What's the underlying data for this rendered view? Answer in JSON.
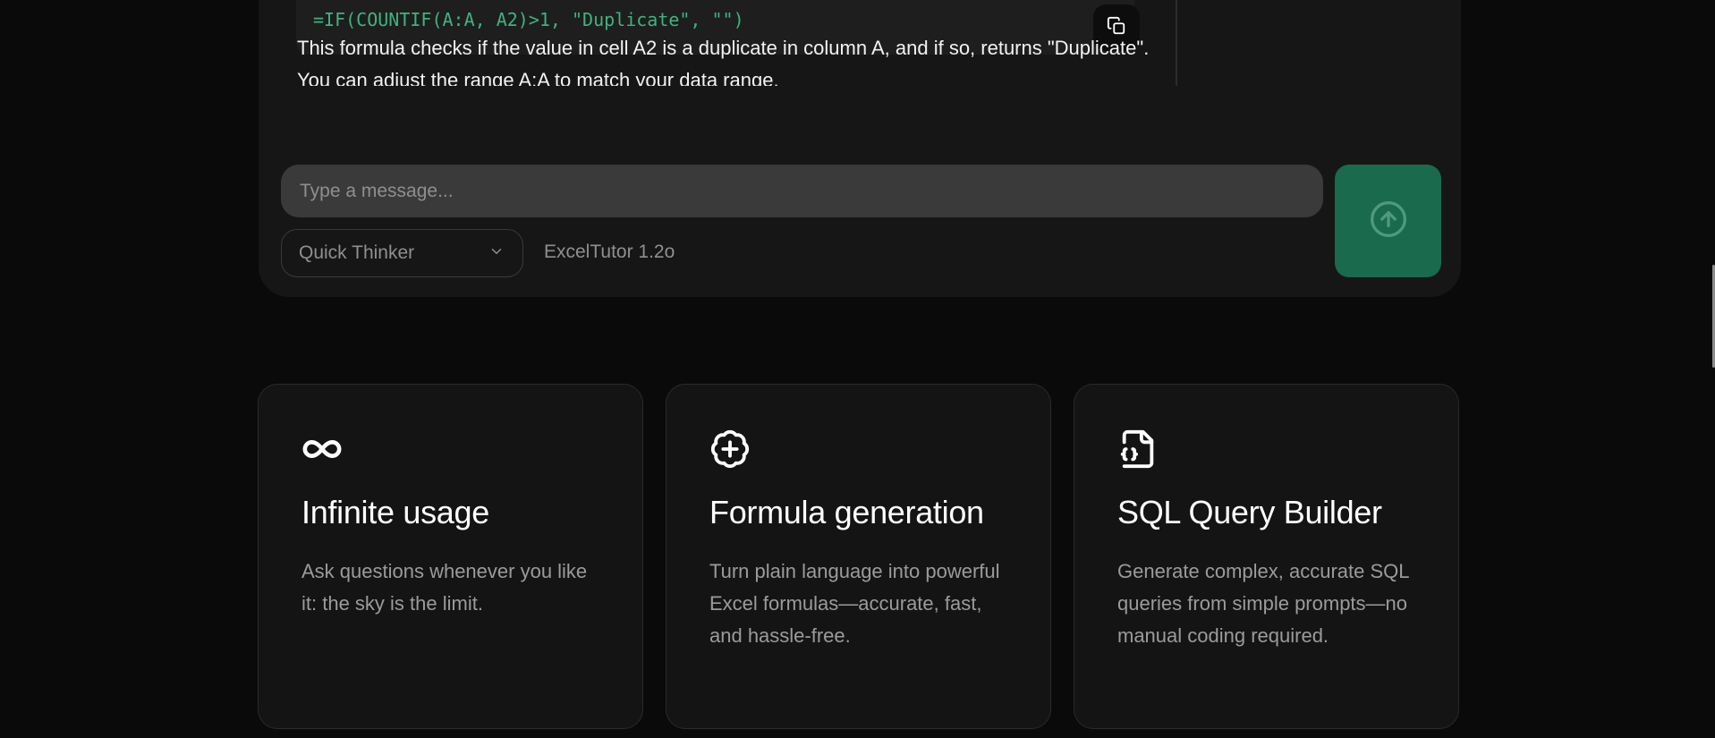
{
  "chat": {
    "code_line": "=IF(COUNTIF(A:A, A2)>1, \"Duplicate\", \"\")",
    "answer": "This formula checks if the value in cell A2 is a duplicate in column A, and if so, returns \"Duplicate\". You can adjust the range A:A to match your data range."
  },
  "composer": {
    "placeholder": "Type a message...",
    "mode_selected": "Quick Thinker",
    "version": "ExcelTutor 1.2o"
  },
  "features": [
    {
      "icon": "infinity-icon",
      "title": "Infinite usage",
      "description": "Ask questions whenever you like it: the sky is the limit."
    },
    {
      "icon": "badge-plus-icon",
      "title": "Formula generation",
      "description": "Turn plain language into powerful Excel formulas—accurate, fast, and hassle-free."
    },
    {
      "icon": "file-code-icon",
      "title": "SQL Query Builder",
      "description": "Generate complex, accurate SQL queries from simple prompts—no manual coding required."
    }
  ],
  "colors": {
    "background": "#0a0a0a",
    "panel": "#161616",
    "code_green": "#3fb27f",
    "send_button": "#1a6a4d"
  }
}
